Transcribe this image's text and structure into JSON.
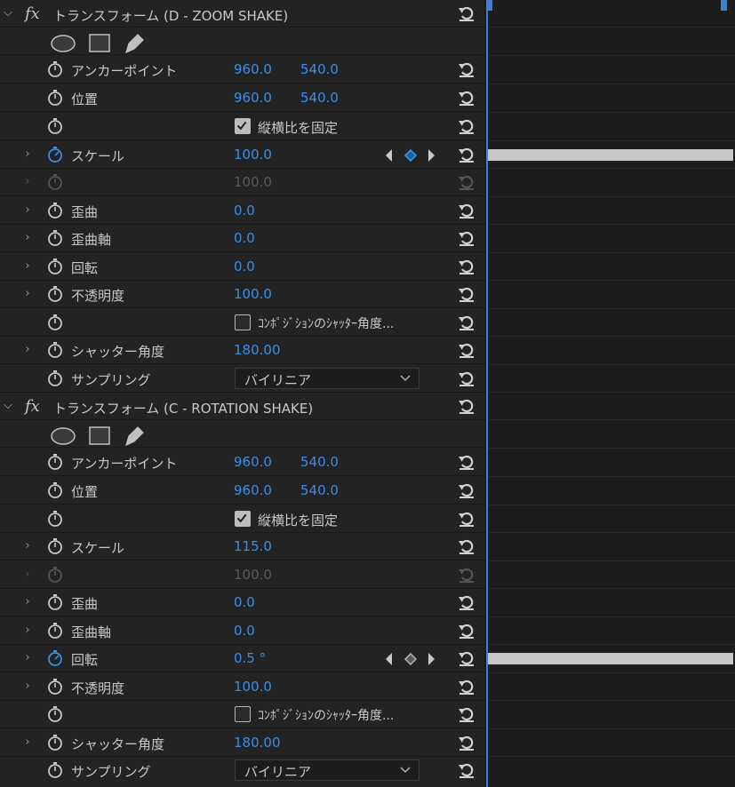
{
  "effects": [
    {
      "fx_label": "fx",
      "name": "トランスフォーム (D - ZOOM SHAKE)",
      "anchor": {
        "label": "アンカーポイント",
        "x": "960.0",
        "y": "540.0"
      },
      "position": {
        "label": "位置",
        "x": "960.0",
        "y": "540.0"
      },
      "uniform_scale": {
        "label": "縦横比を固定",
        "checked": true
      },
      "scale": {
        "label": "スケール",
        "value": "100.0"
      },
      "scale_width": {
        "value": "100.0"
      },
      "skew": {
        "label": "歪曲",
        "value": "0.0"
      },
      "skew_axis": {
        "label": "歪曲軸",
        "value": "0.0"
      },
      "rotation": {
        "label": "回転",
        "value": "0.0"
      },
      "opacity": {
        "label": "不透明度",
        "value": "100.0"
      },
      "comp_shutter": {
        "label": "ｺﾝﾎﾟｼﾞｼｮﾝのｼｬｯﾀｰ角度...",
        "checked": false
      },
      "shutter_angle": {
        "label": "シャッター角度",
        "value": "180.00"
      },
      "sampling": {
        "label": "サンプリング",
        "value": "バイリニア"
      }
    },
    {
      "fx_label": "fx",
      "name": "トランスフォーム (C - ROTATION SHAKE)",
      "anchor": {
        "label": "アンカーポイント",
        "x": "960.0",
        "y": "540.0"
      },
      "position": {
        "label": "位置",
        "x": "960.0",
        "y": "540.0"
      },
      "uniform_scale": {
        "label": "縦横比を固定",
        "checked": true
      },
      "scale": {
        "label": "スケール",
        "value": "115.0"
      },
      "scale_width": {
        "value": "100.0"
      },
      "skew": {
        "label": "歪曲",
        "value": "0.0"
      },
      "skew_axis": {
        "label": "歪曲軸",
        "value": "0.0"
      },
      "rotation": {
        "label": "回転",
        "value": "0.5 °"
      },
      "opacity": {
        "label": "不透明度",
        "value": "100.0"
      },
      "comp_shutter": {
        "label": "ｺﾝﾎﾟｼﾞｼｮﾝのｼｬｯﾀｰ角度...",
        "checked": false
      },
      "shutter_angle": {
        "label": "シャッター角度",
        "value": "180.00"
      },
      "sampling": {
        "label": "サンプリング",
        "value": "バイリニア"
      }
    }
  ],
  "icons": {
    "stopwatch": "stopwatch-icon",
    "reset": "reset-parameter-icon",
    "ellipse": "ellipse-mask-icon",
    "rectangle": "rectangle-mask-icon",
    "pen": "pen-mask-icon",
    "keyframe_prev": "previous-keyframe-icon",
    "keyframe_add": "add-keyframe-icon",
    "keyframe_next": "next-keyframe-icon",
    "chevron": "chevron-down-icon"
  },
  "colors": {
    "value_blue": "#3b8ee6",
    "playhead": "#3e7fd8",
    "panel_bg": "#232323",
    "timeline_bg": "#1d1d1d"
  }
}
